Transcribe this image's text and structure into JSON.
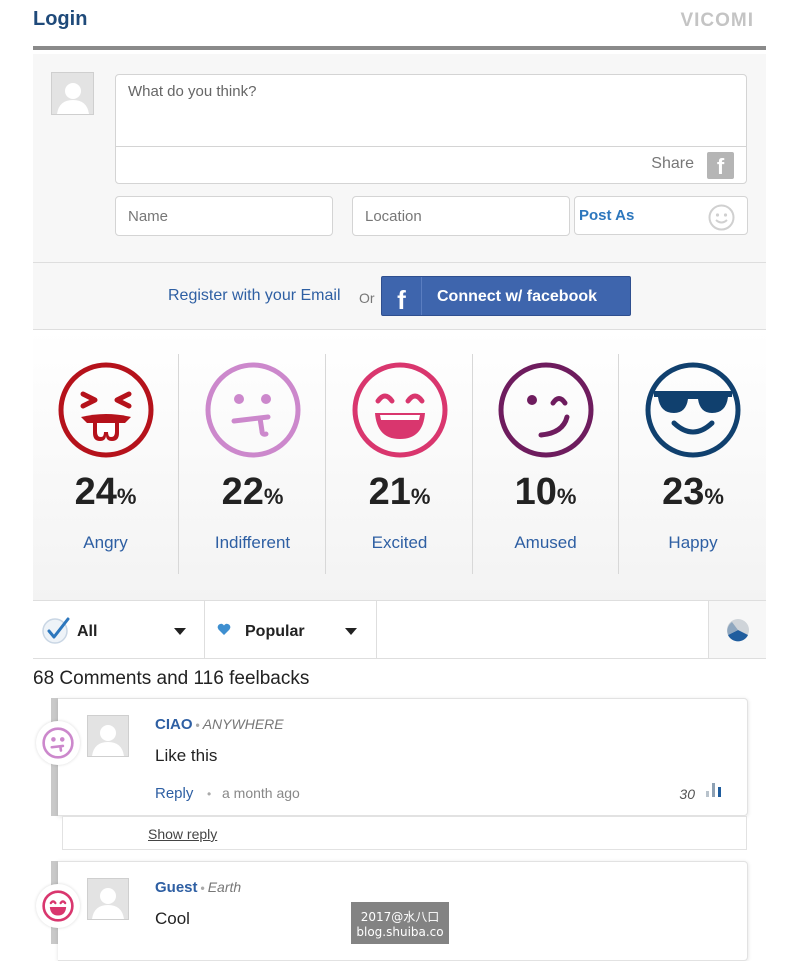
{
  "header": {
    "login_label": "Login",
    "brand": "VICOMI"
  },
  "composer": {
    "placeholder": "What do you think?",
    "share_label": "Share",
    "name_placeholder": "Name",
    "location_placeholder": "Location",
    "post_as_label": "Post As"
  },
  "register": {
    "email_label": "Register with your Email",
    "or_label": "Or",
    "facebook_label": "Connect w/ facebook"
  },
  "reactions": [
    {
      "name": "Angry",
      "value": "24",
      "unit": "%",
      "color": "#b5121b",
      "icon": "angry-face-icon"
    },
    {
      "name": "Indifferent",
      "value": "22",
      "unit": "%",
      "color": "#cc88cc",
      "icon": "indifferent-face-icon"
    },
    {
      "name": "Excited",
      "value": "21",
      "unit": "%",
      "color": "#d9366e",
      "icon": "excited-face-icon"
    },
    {
      "name": "Amused",
      "value": "10",
      "unit": "%",
      "color": "#6e1c5e",
      "icon": "amused-face-icon"
    },
    {
      "name": "Happy",
      "value": "23",
      "unit": "%",
      "color": "#10406e",
      "icon": "happy-sunglasses-face-icon"
    }
  ],
  "filters": {
    "all_label": "All",
    "sort_label": "Popular"
  },
  "summary": "68 Comments and 116 feelbacks",
  "comments": [
    {
      "author": "CIAO",
      "location": "ANYWHERE",
      "text": "Like this",
      "reply_label": "Reply",
      "time": "a month ago",
      "score": "30",
      "emotion": "indifferent-face-icon"
    },
    {
      "author": "Guest",
      "location": "Earth",
      "text": "Cool",
      "emotion": "excited-face-icon"
    }
  ],
  "show_reply_label": "Show reply",
  "watermark": {
    "line1": "2017@水八口",
    "line2": "blog.shuiba.co"
  }
}
